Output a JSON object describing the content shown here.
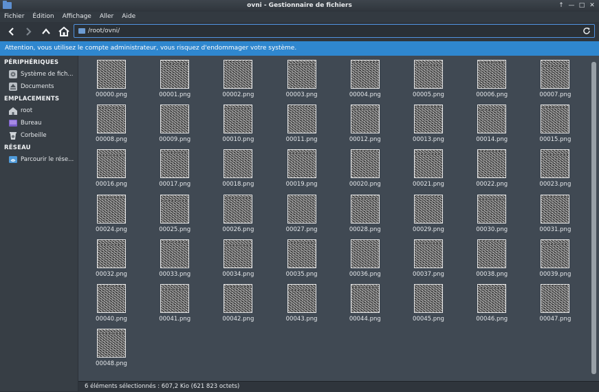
{
  "window": {
    "title": "ovni - Gestionnaire de fichiers",
    "controls": [
      "↑",
      "—",
      "□",
      "✕"
    ]
  },
  "menu": [
    "Fichier",
    "Édition",
    "Affichage",
    "Aller",
    "Aide"
  ],
  "toolbar": {
    "path": "/root/ovni/"
  },
  "infobar": {
    "message": "Attention, vous utilisez le compte administrateur, vous risquez d'endommager votre système."
  },
  "sidebar": {
    "sections": [
      {
        "title": "PÉRIPHÉRIQUES",
        "items": [
          {
            "label": "Système de fich...",
            "icon": "hard-disk-icon"
          },
          {
            "label": "Documents",
            "icon": "eject-drive-icon"
          }
        ]
      },
      {
        "title": "EMPLACEMENTS",
        "items": [
          {
            "label": "root",
            "icon": "home-folder-icon"
          },
          {
            "label": "Bureau",
            "icon": "desktop-icon"
          },
          {
            "label": "Corbeille",
            "icon": "trash-icon"
          }
        ]
      },
      {
        "title": "RÉSEAU",
        "items": [
          {
            "label": "Parcourir le rése...",
            "icon": "network-icon"
          }
        ]
      }
    ]
  },
  "files": [
    "00000.png",
    "00001.png",
    "00002.png",
    "00003.png",
    "00004.png",
    "00005.png",
    "00006.png",
    "00007.png",
    "00008.png",
    "00009.png",
    "00010.png",
    "00011.png",
    "00012.png",
    "00013.png",
    "00014.png",
    "00015.png",
    "00016.png",
    "00017.png",
    "00018.png",
    "00019.png",
    "00020.png",
    "00021.png",
    "00022.png",
    "00023.png",
    "00024.png",
    "00025.png",
    "00026.png",
    "00027.png",
    "00028.png",
    "00029.png",
    "00030.png",
    "00031.png",
    "00032.png",
    "00033.png",
    "00034.png",
    "00035.png",
    "00036.png",
    "00037.png",
    "00038.png",
    "00039.png",
    "00040.png",
    "00041.png",
    "00042.png",
    "00043.png",
    "00044.png",
    "00045.png",
    "00046.png",
    "00047.png",
    "00048.png"
  ],
  "statusbar": {
    "text": "6 éléments sélectionnés : 607,2 Kio (621 823 octets)"
  },
  "colors": {
    "accent": "#2f87cf",
    "focus_border": "#5294e2",
    "background": "#404953"
  }
}
